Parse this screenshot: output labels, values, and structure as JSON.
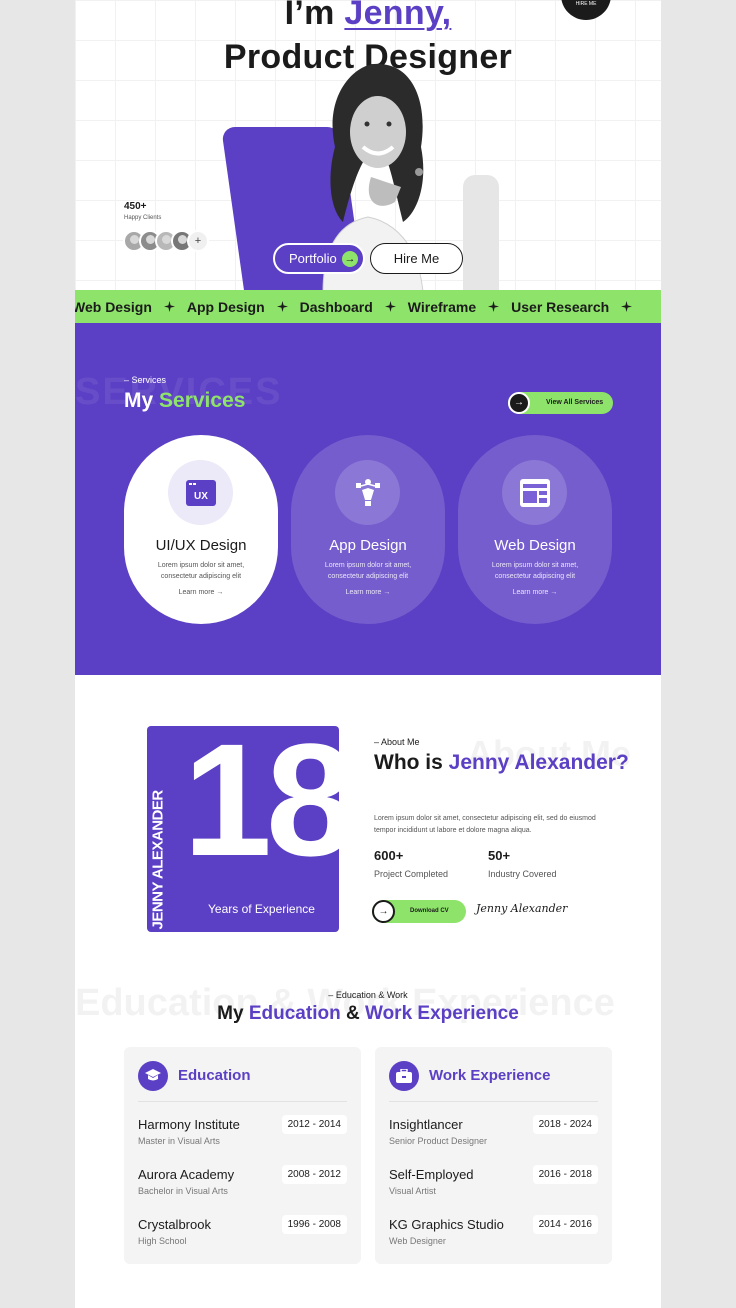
{
  "hero": {
    "title_prefix": "I’m ",
    "title_name": "Jenny,",
    "title_role": "Product Designer",
    "clients_count": "450+",
    "clients_label": "Happy Clients",
    "avatar_more": "+",
    "portfolio_label": "Portfolio",
    "hire_label": "Hire Me",
    "seal_text": "HIRE ME"
  },
  "marquee": {
    "items": [
      "Web Design",
      "App Design",
      "Dashboard",
      "Wireframe",
      "User Research"
    ]
  },
  "services": {
    "ghost": "SERVICES",
    "eyebrow": "Services",
    "title_a": "My ",
    "title_b": "Services",
    "view_all": "View All Services",
    "cards": [
      {
        "title": "UI/UX Design",
        "desc": "Lorem ipsum dolor sit amet, consectetur adipiscing elit",
        "link": "Learn more",
        "icon": "ux-window-icon",
        "icon_text": "UX"
      },
      {
        "title": "App Design",
        "desc": "Lorem ipsum dolor sit amet, consectetur adipiscing elit",
        "link": "Learn more",
        "icon": "pen-tool-icon"
      },
      {
        "title": "Web Design",
        "desc": "Lorem ipsum dolor sit amet, consectetur adipiscing elit",
        "link": "Learn more",
        "icon": "browser-layout-icon"
      }
    ]
  },
  "about": {
    "vertical_name": "JENNY ALEXANDER",
    "years_number": "18",
    "years_label": "Years of Experience",
    "ghost": "About Me",
    "eyebrow": "About Me",
    "title_a": "Who is ",
    "title_b": "Jenny Alexander?",
    "desc": "Lorem ipsum dolor sit amet, consectetur adipiscing elit, sed do eiusmod tempor incididunt ut labore et dolore magna aliqua.",
    "stats": [
      {
        "value": "600+",
        "label": "Project Completed"
      },
      {
        "value": "50+",
        "label": "Industry Covered"
      }
    ],
    "download_label": "Download CV",
    "signature": "Jenny Alexander"
  },
  "education": {
    "ghost": "Education & Work Experience",
    "eyebrow": "Education & Work",
    "title_a": "My ",
    "title_b": "Education",
    "title_c": " & ",
    "title_d": "Work Experience",
    "panels": [
      {
        "heading": "Education",
        "icon": "graduation-cap-icon",
        "rows": [
          {
            "title": "Harmony Institute",
            "sub": "Master in Visual Arts",
            "period": "2012 - 2014"
          },
          {
            "title": "Aurora Academy",
            "sub": "Bachelor in Visual Arts",
            "period": "2008 - 2012"
          },
          {
            "title": "Crystalbrook",
            "sub": "High School",
            "period": "1996 - 2008"
          }
        ]
      },
      {
        "heading": "Work Experience",
        "icon": "briefcase-icon",
        "rows": [
          {
            "title": "Insightlancer",
            "sub": "Senior Product Designer",
            "period": "2018 - 2024"
          },
          {
            "title": "Self-Employed",
            "sub": "Visual Artist",
            "period": "2016 - 2018"
          },
          {
            "title": "KG Graphics Studio",
            "sub": "Web Designer",
            "period": "2014 - 2016"
          }
        ]
      }
    ]
  },
  "colors": {
    "primary": "#5b3fc4",
    "accent_green": "#8ee36a",
    "text_dark": "#1b1b1b"
  }
}
